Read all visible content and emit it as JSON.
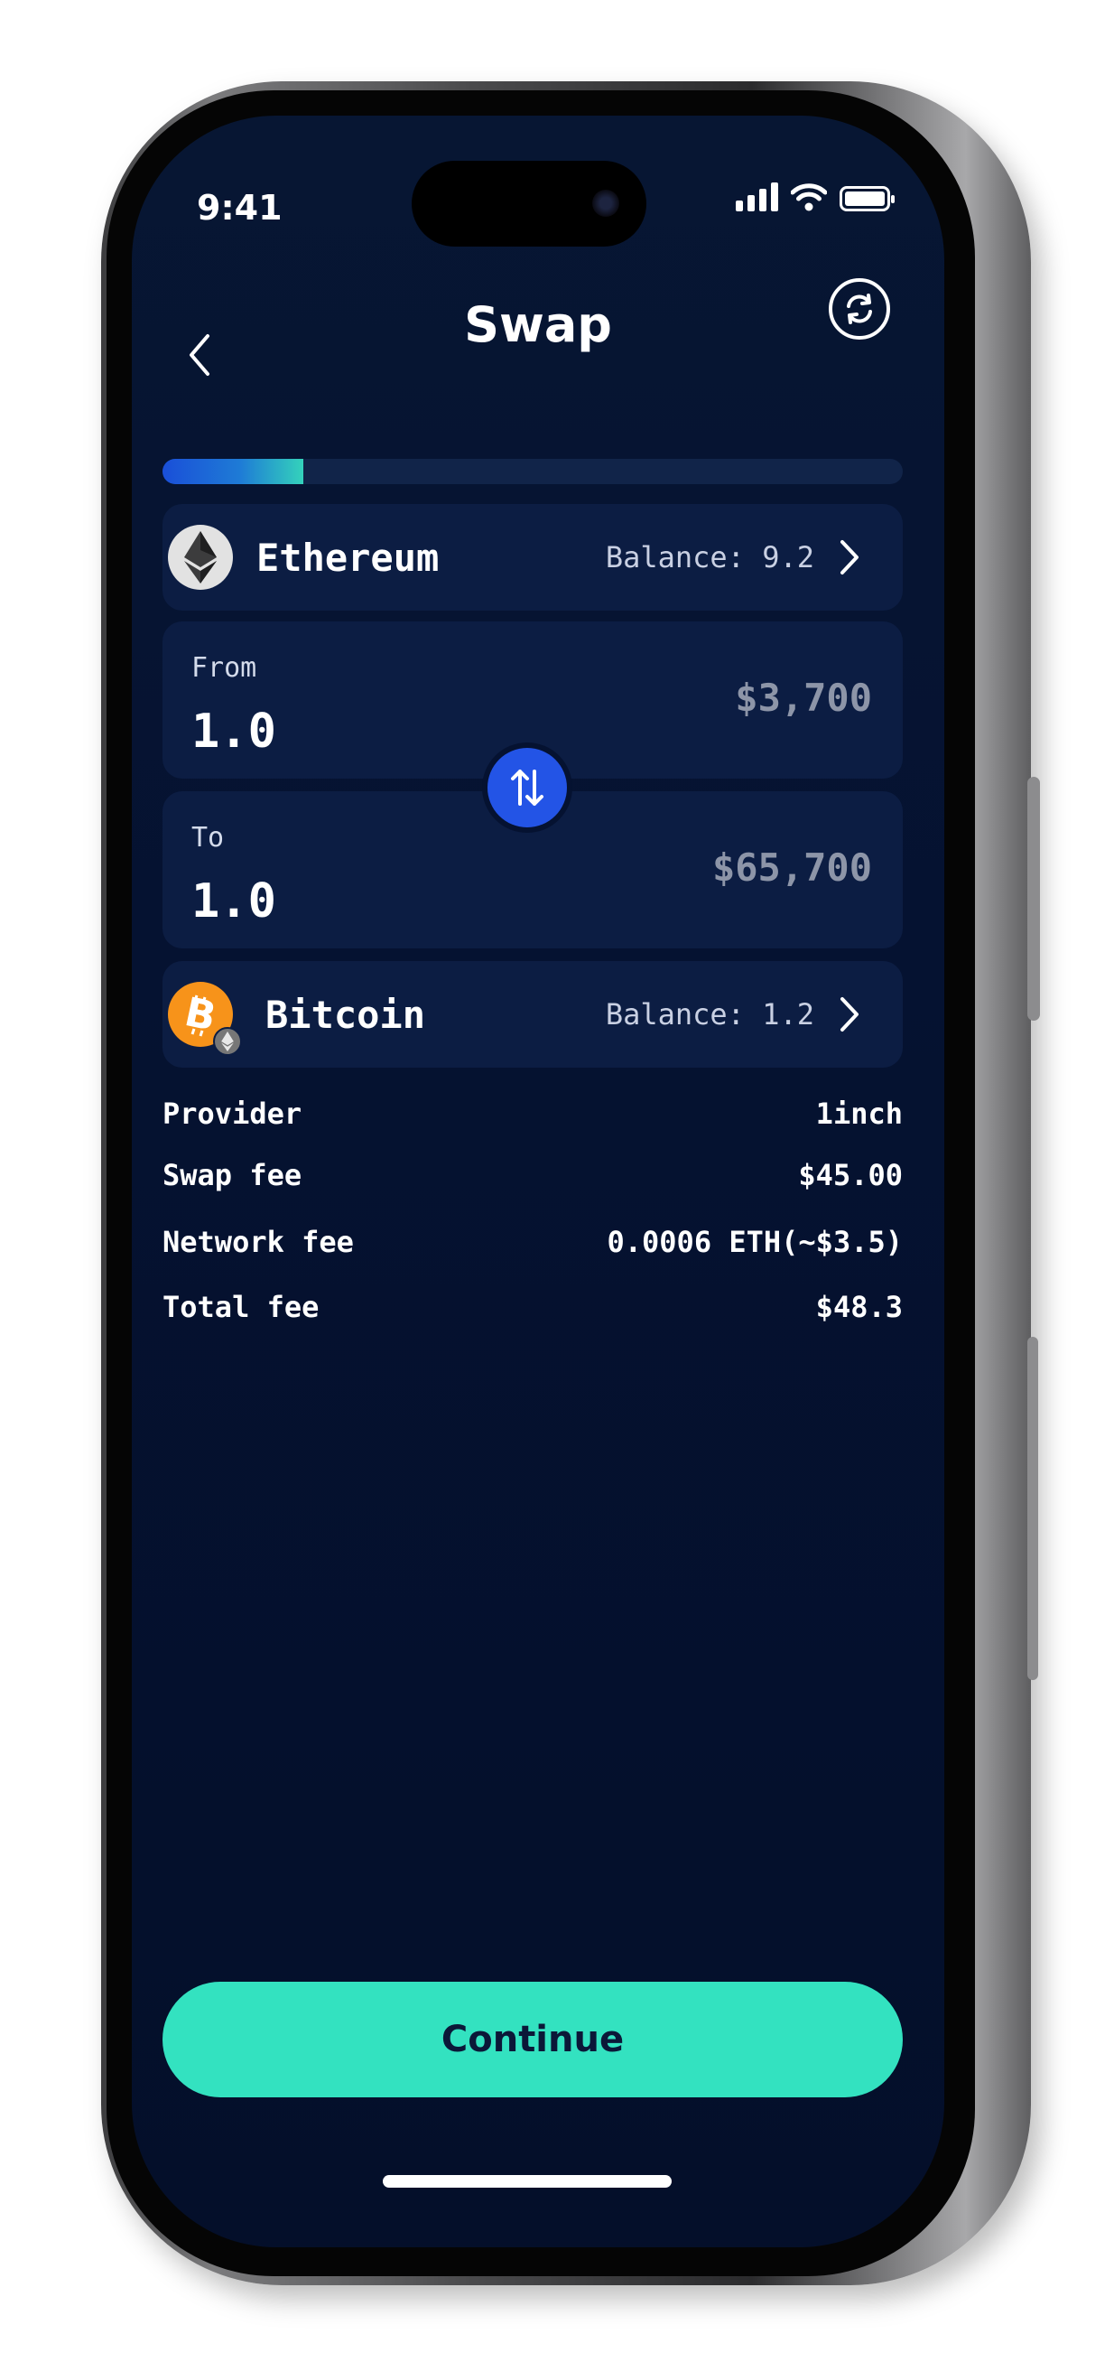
{
  "status_bar": {
    "time": "9:41"
  },
  "header": {
    "title": "Swap"
  },
  "progress": {
    "fraction": 0.19
  },
  "from_asset": {
    "name": "Ethereum",
    "balance": "Balance: 9.2",
    "icon": "ethereum-icon"
  },
  "from_amount": {
    "label": "From",
    "value": "1.0",
    "fiat": "$3,700"
  },
  "to_amount": {
    "label": "To",
    "value": "1.0",
    "fiat": "$65,700"
  },
  "to_asset": {
    "name": "Bitcoin",
    "balance": "Balance: 1.2",
    "icon": "bitcoin-icon"
  },
  "fees": [
    {
      "label": "Provider",
      "value": "1inch"
    },
    {
      "label": "Swap fee",
      "value": "$45.00"
    },
    {
      "label": "Network fee",
      "value": "0.0006 ETH(~$3.5)"
    },
    {
      "label": "Total fee",
      "value": "$48.3"
    }
  ],
  "actions": {
    "continue_label": "Continue"
  },
  "colors": {
    "background": "#051231",
    "card": "#0c1d43",
    "accent": "#33e2c0",
    "swap_button": "#2354e6",
    "bitcoin": "#f7931a"
  }
}
